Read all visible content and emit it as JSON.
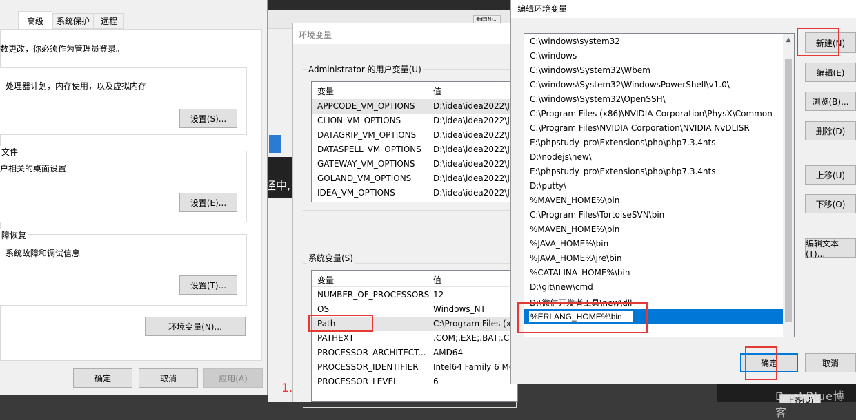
{
  "sysprops": {
    "tabs": [
      "高级",
      "系统保护",
      "远程"
    ],
    "admin_note": "数更改，你必须作为管理员登录。",
    "perf_desc": "处理器计划，内存使用，以及虚拟内存",
    "perf_btn": "设置(S)...",
    "profile_title": "文件",
    "profile_desc": "户相关的桌面设置",
    "profile_btn": "设置(E)...",
    "startup_title": "障恢复",
    "startup_desc": "系统故障和调试信息",
    "startup_btn": "设置(T)...",
    "env_btn": "环境变量(N)...",
    "ok": "确定",
    "cancel": "取消",
    "apply": "应用(A)"
  },
  "envwin": {
    "title": "环境变量",
    "user_group": "Administrator 的用户变量(U)",
    "sys_group": "系统变量(S)",
    "col_var": "变量",
    "col_val": "值",
    "user_vars": [
      {
        "name": "APPCODE_VM_OPTIONS",
        "value": "D:\\idea\\idea2022\\Je"
      },
      {
        "name": "CLION_VM_OPTIONS",
        "value": "D:\\idea\\idea2022\\Je"
      },
      {
        "name": "DATAGRIP_VM_OPTIONS",
        "value": "D:\\idea\\idea2022\\Je"
      },
      {
        "name": "DATASPELL_VM_OPTIONS",
        "value": "D:\\idea\\idea2022\\Je"
      },
      {
        "name": "GATEWAY_VM_OPTIONS",
        "value": "D:\\idea\\idea2022\\Je"
      },
      {
        "name": "GOLAND_VM_OPTIONS",
        "value": "D:\\idea\\idea2022\\Je"
      },
      {
        "name": "IDEA_VM_OPTIONS",
        "value": "D:\\idea\\idea2022\\Je"
      }
    ],
    "sys_vars": [
      {
        "name": "NUMBER_OF_PROCESSORS",
        "value": "12"
      },
      {
        "name": "OS",
        "value": "Windows_NT"
      },
      {
        "name": "Path",
        "value": "C:\\Program Files (x8"
      },
      {
        "name": "PATHEXT",
        "value": ".COM;.EXE;.BAT;.CM"
      },
      {
        "name": "PROCESSOR_ARCHITECT...",
        "value": "AMD64"
      },
      {
        "name": "PROCESSOR_IDENTIFIER",
        "value": "Intel64 Family 6 Mo"
      },
      {
        "name": "PROCESSOR_LEVEL",
        "value": "6"
      }
    ]
  },
  "background": {
    "small_button": "新建(N)...",
    "snippet": "径中,",
    "marker": "1."
  },
  "editwin": {
    "title": "编辑环境变量",
    "paths": [
      "C:\\windows\\system32",
      "C:\\windows",
      "C:\\windows\\System32\\Wbem",
      "C:\\windows\\System32\\WindowsPowerShell\\v1.0\\",
      "C:\\windows\\System32\\OpenSSH\\",
      "C:\\Program Files (x86)\\NVIDIA Corporation\\PhysX\\Common",
      "C:\\Program Files\\NVIDIA Corporation\\NVIDIA NvDLISR",
      "E:\\phpstudy_pro\\Extensions\\php\\php7.3.4nts",
      "D:\\nodejs\\new\\",
      "E:\\phpstudy_pro\\Extensions\\php\\php7.3.4nts",
      "D:\\putty\\",
      "%MAVEN_HOME%\\bin",
      "C:\\Program Files\\TortoiseSVN\\bin",
      "%MAVEN_HOME%\\bin",
      "%JAVA_HOME%\\bin",
      "%JAVA_HOME%\\jre\\bin",
      "%CATALINA_HOME%\\bin",
      "D:\\git\\new\\cmd",
      "D:\\微信开发者工具\\new\\dll"
    ],
    "editing_value": "%ERLANG_HOME%\\bin",
    "btn_new": "新建(N)",
    "btn_edit": "编辑(E)",
    "btn_browse": "浏览(B)...",
    "btn_delete": "删除(D)",
    "btn_up": "上移(U)",
    "btn_down": "下移(O)",
    "btn_edit_text": "编辑文本(T)...",
    "ok": "确定",
    "cancel": "取消",
    "footer_partial": "上移(U)",
    "watermark": "DuckBlue博客"
  }
}
